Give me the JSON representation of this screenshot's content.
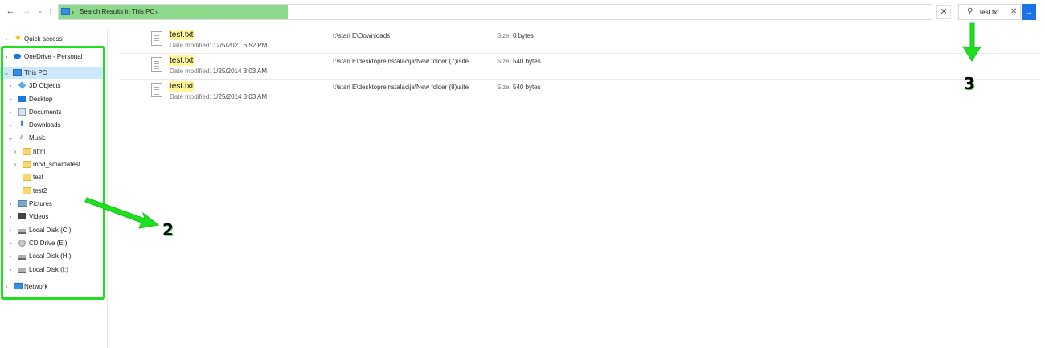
{
  "toolbar": {
    "back": "←",
    "forward": "→",
    "recent": "⌄",
    "up": "↑"
  },
  "address": {
    "path": "Search Results in This PC",
    "sep": "›"
  },
  "search": {
    "value": "test.txt",
    "clear": "✕",
    "go": "→"
  },
  "sidebar": {
    "items": [
      {
        "label": "Quick access",
        "icon": "star-icon"
      },
      {
        "label": "OneDrive - Personal",
        "icon": "cloud-icon"
      },
      {
        "label": "This PC",
        "icon": "computer-icon"
      },
      {
        "label": "3D Objects",
        "icon": "cube-icon"
      },
      {
        "label": "Desktop",
        "icon": "desktop-icon"
      },
      {
        "label": "Documents",
        "icon": "documents-icon"
      },
      {
        "label": "Downloads",
        "icon": "download-icon"
      },
      {
        "label": "Music",
        "icon": "music-note-icon"
      },
      {
        "label": "html",
        "icon": "folder-icon"
      },
      {
        "label": "mod_smartlatest",
        "icon": "folder-icon"
      },
      {
        "label": "test",
        "icon": "folder-icon"
      },
      {
        "label": "test2",
        "icon": "folder-icon"
      },
      {
        "label": "Pictures",
        "icon": "pictures-icon"
      },
      {
        "label": "Videos",
        "icon": "videos-icon"
      },
      {
        "label": "Local Disk (C:)",
        "icon": "disk-icon"
      },
      {
        "label": "CD Drive (E:)",
        "icon": "cd-drive-icon"
      },
      {
        "label": "Local Disk (H:)",
        "icon": "disk-icon"
      },
      {
        "label": "Local Disk (I:)",
        "icon": "disk-icon"
      },
      {
        "label": "Network",
        "icon": "network-icon"
      }
    ]
  },
  "results": {
    "date_label": "Date modified:",
    "size_label": "Size:",
    "items": [
      {
        "name": "test.txt",
        "date": "12/5/2021 6:52 PM",
        "path": "I:\\stari E\\Downloads",
        "size": "0 bytes"
      },
      {
        "name": "test.txt",
        "date": "1/25/2014 3:03 AM",
        "path": "I:\\stari E\\desktopreinstalacija\\New folder (7)\\site",
        "size": "540 bytes"
      },
      {
        "name": "test.txt",
        "date": "1/25/2014 3:03 AM",
        "path": "I:\\stari E\\desktopreinstalacija\\New folder (8)\\site",
        "size": "540 bytes"
      }
    ]
  },
  "annotations": {
    "label_2": "2",
    "label_3": "3",
    "color": "#1ee01e"
  }
}
